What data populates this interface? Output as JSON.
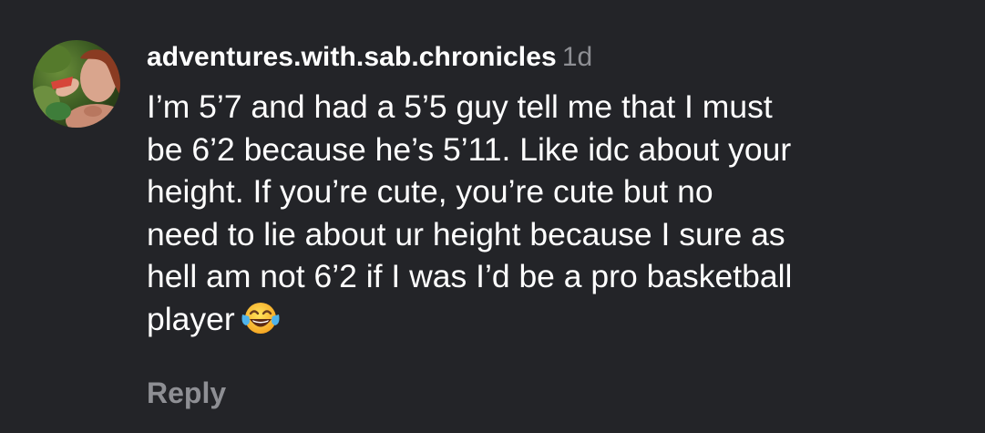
{
  "comment": {
    "username": "adventures.with.sab.chronicles",
    "timestamp": "1d",
    "text_lines": [
      "I’m 5’7 and had a 5’5 guy tell me that I must",
      "be 6’2 because he’s 5’11. Like idc about your",
      "height. If you’re cute, you’re cute but no",
      "need to lie about ur height because I sure as",
      "hell am not 6’2 if I was I’d be a pro basketball",
      "player"
    ],
    "emoji_icon": "face-with-tears-of-joy-icon",
    "avatar_icon": "profile-photo-avatar",
    "reply_label": "Reply"
  },
  "colors": {
    "background": "#232428",
    "text": "#ffffff",
    "muted": "#8e8f94"
  }
}
